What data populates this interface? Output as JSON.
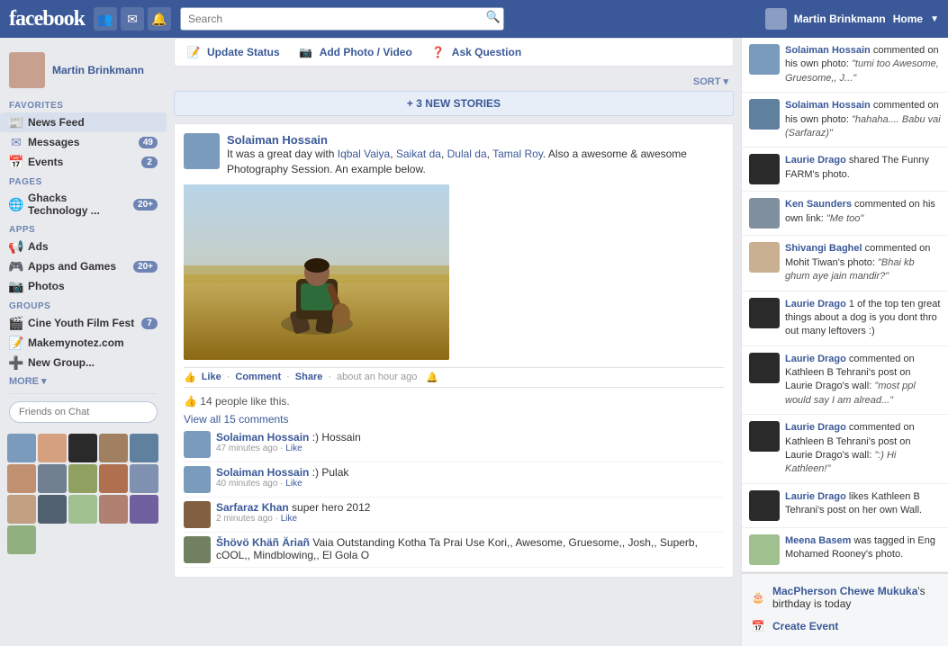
{
  "topnav": {
    "logo": "facebook",
    "search_placeholder": "Search",
    "user_name": "Martin Brinkmann",
    "home_label": "Home"
  },
  "sidebar": {
    "profile_name": "Martin Brinkmann",
    "sections": {
      "favorites_title": "FAVORITES",
      "pages_title": "PAGES",
      "apps_title": "APPS",
      "groups_title": "GROUPS"
    },
    "favorites": [
      {
        "label": "News Feed",
        "badge": "",
        "active": true
      },
      {
        "label": "Messages",
        "badge": "49",
        "active": false
      },
      {
        "label": "Events",
        "badge": "2",
        "active": false
      }
    ],
    "pages": [
      {
        "label": "Ghacks Technology ...",
        "badge": "20+",
        "active": false
      }
    ],
    "apps": [
      {
        "label": "Ads",
        "badge": "",
        "active": false
      },
      {
        "label": "Apps and Games",
        "badge": "20+",
        "active": false
      },
      {
        "label": "Photos",
        "badge": "",
        "active": false
      }
    ],
    "groups": [
      {
        "label": "Cine Youth Film Fest",
        "badge": "7",
        "active": false
      },
      {
        "label": "Makemynotez.com",
        "badge": "",
        "active": false
      },
      {
        "label": "New Group...",
        "badge": "",
        "active": false
      }
    ],
    "more_label": "MORE ▾",
    "chat_search_placeholder": "Friends on Chat"
  },
  "feed": {
    "update_status_label": "Update Status",
    "add_photo_label": "Add Photo / Video",
    "ask_question_label": "Ask Question",
    "sort_label": "SORT",
    "new_stories_label": "+ 3 NEW STORIES"
  },
  "post": {
    "author": "Solaiman Hossain",
    "text": "It was a great day with Iqbal Vaiya, Saikat da, Dulal da, Tamal Roy. Also a awesome & awesome Photography Session. An example below.",
    "like_label": "Like",
    "comment_label": "Comment",
    "share_label": "Share",
    "time_label": "about an hour ago",
    "likes_text": "14 people like this.",
    "view_comments_label": "View all 15 comments",
    "comments": [
      {
        "author": "Solaiman Hossain",
        "text": ":) Hossain",
        "time": "47 minutes ago",
        "like": "Like"
      },
      {
        "author": "Solaiman Hossain",
        "text": ":) Pulak",
        "time": "40 minutes ago",
        "like": "Like"
      },
      {
        "author": "Sarfaraz Khan",
        "text": "super hero 2012",
        "time": "2 minutes ago",
        "like": "Like"
      },
      {
        "author": "Šhövö Khäñ Äriañ",
        "text": "Vaia Outstanding Kotha Ta Prai Use Kori,, Awesome, Gruesome,, Josh,, Superb, cOOL,, Mindblowing,, El Gola O",
        "time": "",
        "like": ""
      }
    ]
  },
  "ticker": {
    "items": [
      {
        "person": "Solaiman Hossain",
        "action": "commented on his own photo:",
        "quote": "\"tumi too Awesome, Gruesome,, J...\""
      },
      {
        "person": "Solaiman Hossain",
        "action": "commented on his own photo:",
        "quote": "\"hahaha.... Babu vai (Sarfaraz)\""
      },
      {
        "person": "Laurie Drago",
        "action": "shared The Funny FARM's photo.",
        "quote": ""
      },
      {
        "person": "Ken Saunders",
        "action": "commented on his own link:",
        "quote": "\"Me too\""
      },
      {
        "person": "Shivangi Baghel",
        "action": "commented on Mohit Tiwan's photo:",
        "quote": "\"Bhai kb ghum aye jain mandir?\""
      },
      {
        "person": "Laurie Drago",
        "action": "1 of the top ten great things about a dog is you dont thro out many leftovers :)",
        "quote": ""
      },
      {
        "person": "Laurie Drago",
        "action": "commented on Kathleen B Tehrani's post on Laurie Drago's wall:",
        "quote": "\"most ppl would say I am alread...\""
      },
      {
        "person": "Laurie Drago",
        "action": "commented on Kathleen B Tehrani's post on Laurie Drago's wall:",
        "quote": "\":) Hi Kathleen!\""
      },
      {
        "person": "Laurie Drago",
        "action": "likes Kathleen B Tehrani's post on her own Wall.",
        "quote": ""
      },
      {
        "person": "Meena Basem",
        "action": "was tagged in Eng Mohamed Rooney's photo.",
        "quote": ""
      }
    ],
    "birthday": {
      "text_before": "",
      "name": "MacPherson Chewe Mukuka",
      "text_after": "'s birthday is today"
    },
    "create_event_label": "Create Event"
  }
}
